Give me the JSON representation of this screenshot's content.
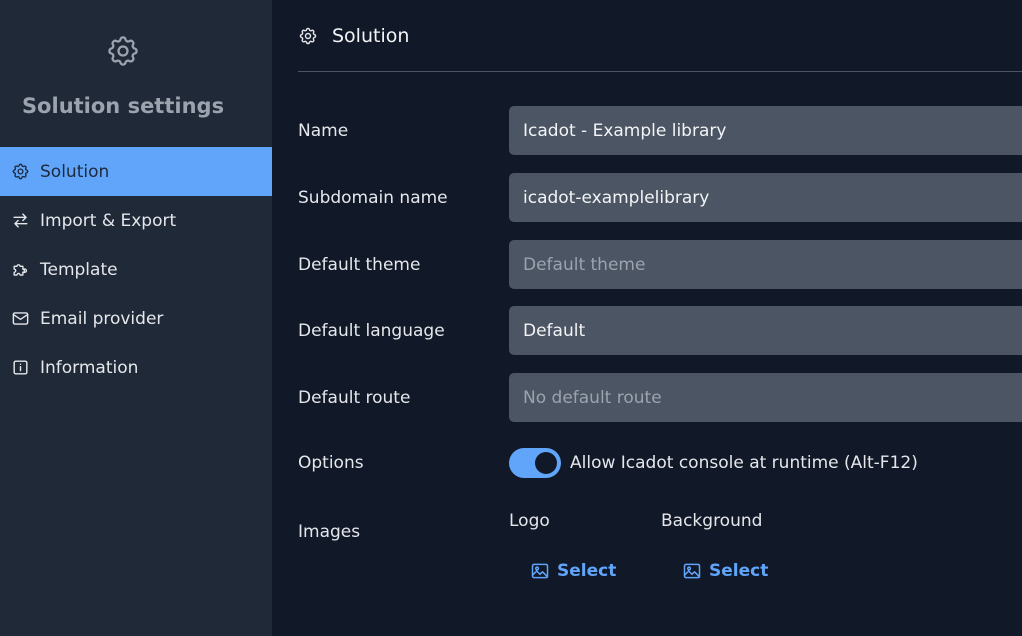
{
  "sidebar": {
    "title": "Solution settings",
    "items": [
      {
        "label": "Solution",
        "icon": "gear-icon",
        "active": true
      },
      {
        "label": "Import & Export",
        "icon": "arrows-exchange-icon",
        "active": false
      },
      {
        "label": "Template",
        "icon": "puzzle-icon",
        "active": false
      },
      {
        "label": "Email provider",
        "icon": "envelope-icon",
        "active": false
      },
      {
        "label": "Information",
        "icon": "info-icon",
        "active": false
      }
    ]
  },
  "header": {
    "title": "Solution"
  },
  "form": {
    "name": {
      "label": "Name",
      "value": "Icadot - Example library"
    },
    "subdomain": {
      "label": "Subdomain name",
      "value": "icadot-examplelibrary"
    },
    "theme": {
      "label": "Default theme",
      "placeholder": "Default theme"
    },
    "language": {
      "label": "Default language",
      "value": "Default"
    },
    "route": {
      "label": "Default route",
      "placeholder": "No default route"
    },
    "options": {
      "label": "Options",
      "toggle_label": "Allow Icadot console at runtime (Alt-F12)",
      "enabled": true
    },
    "images": {
      "label": "Images",
      "logo": {
        "label": "Logo",
        "button": "Select"
      },
      "background": {
        "label": "Background",
        "button": "Select"
      }
    }
  },
  "colors": {
    "accent": "#60a5fa",
    "sidebar_bg": "#1f2937",
    "main_bg": "#111827",
    "input_bg": "#4b5563"
  }
}
